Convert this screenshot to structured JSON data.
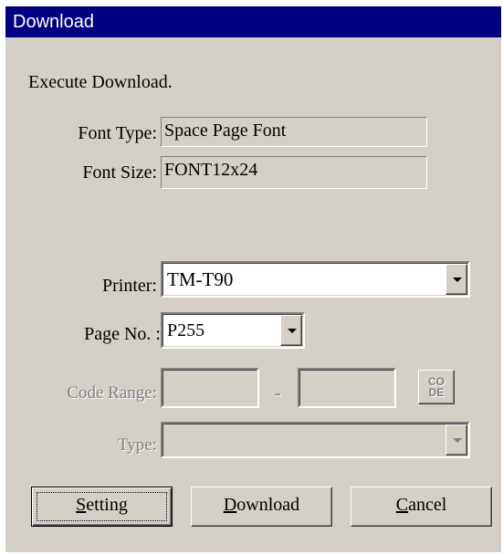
{
  "window": {
    "title": "Download"
  },
  "message": "Execute Download.",
  "font_type": {
    "label": "Font Type:",
    "value": "Space Page Font"
  },
  "font_size": {
    "label": "Font Size:",
    "value": "FONT12x24"
  },
  "printer": {
    "label": "Printer:",
    "value": "TM-T90"
  },
  "page_no": {
    "label": "Page No. :",
    "value": "P255"
  },
  "code_range": {
    "label": "Code Range:",
    "from": "",
    "separator": "-",
    "to": "",
    "code_button_top": "CO",
    "code_button_bottom": "DE"
  },
  "type": {
    "label": "Type:",
    "value": ""
  },
  "buttons": {
    "setting": {
      "underline": "S",
      "rest": "etting"
    },
    "download": {
      "underline": "D",
      "rest": "ownload"
    },
    "cancel": {
      "underline": "C",
      "rest": "ancel"
    }
  },
  "icons": {
    "dropdown": "chevron-down-icon"
  },
  "colors": {
    "titlebar": "#000080",
    "face": "#d4d0c8",
    "disabled": "#808080"
  }
}
